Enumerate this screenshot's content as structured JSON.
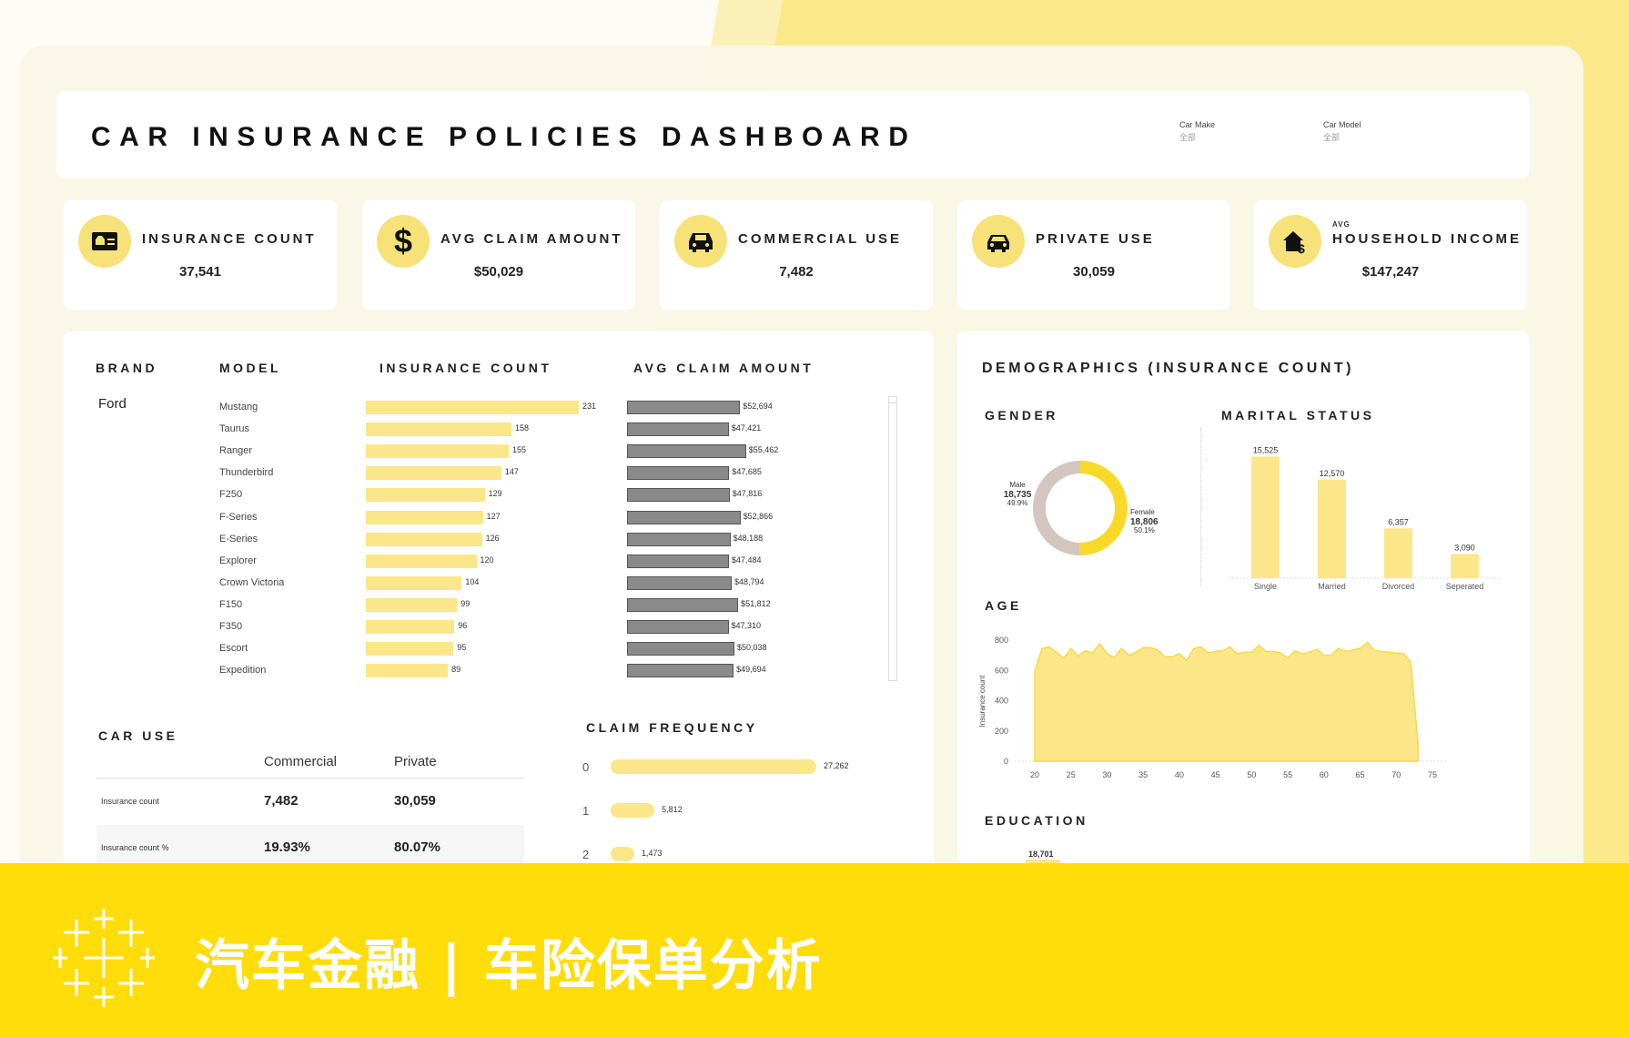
{
  "header": {
    "title": "CAR INSURANCE POLICIES DASHBOARD",
    "filters": [
      {
        "label": "Car Make",
        "value": "全部"
      },
      {
        "label": "Car Model",
        "value": "全部"
      }
    ]
  },
  "kpis": [
    {
      "icon": "id-card-icon",
      "label": "INSURANCE COUNT",
      "sup": "",
      "value": "37,541"
    },
    {
      "icon": "dollar-icon",
      "label": "AVG CLAIM AMOUNT",
      "sup": "",
      "value": "$50,029"
    },
    {
      "icon": "commercial-car-icon",
      "label": "COMMERCIAL USE",
      "sup": "",
      "value": "7,482"
    },
    {
      "icon": "car-icon",
      "label": "PRIVATE USE",
      "sup": "",
      "value": "30,059"
    },
    {
      "icon": "house-dollar-icon",
      "label": "HOUSEHOLD INCOME",
      "sup": "AVG",
      "value": "$147,247"
    }
  ],
  "models_table": {
    "headers": {
      "brand": "BRAND",
      "model": "MODEL",
      "count": "INSURANCE COUNT",
      "claim": "AVG CLAIM AMOUNT"
    },
    "brand": "Ford",
    "rows": [
      {
        "model": "Mustang",
        "count": 231,
        "count_label": "231",
        "claim": 52694,
        "claim_label": "$52,694"
      },
      {
        "model": "Taurus",
        "count": 158,
        "count_label": "158",
        "claim": 47421,
        "claim_label": "$47,421"
      },
      {
        "model": "Ranger",
        "count": 155,
        "count_label": "155",
        "claim": 55462,
        "claim_label": "$55,462"
      },
      {
        "model": "Thunderbird",
        "count": 147,
        "count_label": "147",
        "claim": 47685,
        "claim_label": "$47,685"
      },
      {
        "model": "F250",
        "count": 129,
        "count_label": "129",
        "claim": 47816,
        "claim_label": "$47,816"
      },
      {
        "model": "F-Series",
        "count": 127,
        "count_label": "127",
        "claim": 52866,
        "claim_label": "$52,866"
      },
      {
        "model": "E-Series",
        "count": 126,
        "count_label": "126",
        "claim": 48188,
        "claim_label": "$48,188"
      },
      {
        "model": "Explorer",
        "count": 120,
        "count_label": "120",
        "claim": 47484,
        "claim_label": "$47,484"
      },
      {
        "model": "Crown Victoria",
        "count": 104,
        "count_label": "104",
        "claim": 48794,
        "claim_label": "$48,794"
      },
      {
        "model": "F150",
        "count": 99,
        "count_label": "99",
        "claim": 51812,
        "claim_label": "$51,812"
      },
      {
        "model": "F350",
        "count": 96,
        "count_label": "96",
        "claim": 47310,
        "claim_label": "$47,310"
      },
      {
        "model": "Escort",
        "count": 95,
        "count_label": "95",
        "claim": 50038,
        "claim_label": "$50,038"
      },
      {
        "model": "Expedition",
        "count": 89,
        "count_label": "89",
        "claim": 49694,
        "claim_label": "$49,694"
      }
    ]
  },
  "car_use": {
    "title": "CAR USE",
    "columns": [
      "Commercial",
      "Private"
    ],
    "rows": [
      {
        "label": "Insurance count",
        "values": [
          "7,482",
          "30,059"
        ]
      },
      {
        "label": "Insurance count %",
        "values": [
          "19.93%",
          "80.07%"
        ]
      }
    ]
  },
  "claim_frequency": {
    "title": "CLAIM FREQUENCY",
    "rows": [
      {
        "label": "0",
        "value": 27262,
        "value_label": "27,262"
      },
      {
        "label": "1",
        "value": 5812,
        "value_label": "5,812"
      },
      {
        "label": "2",
        "value": 1473,
        "value_label": "1,473"
      }
    ]
  },
  "demographics": {
    "title": "DEMOGRAPHICS (INSURANCE COUNT)",
    "gender_title": "GENDER",
    "marital_title": "MARITAL STATUS",
    "age_title": "AGE",
    "education_title": "EDUCATION",
    "education_first_label": "18,701",
    "colors": {
      "female": "#f7d92a",
      "male": "#d2c6bf",
      "bar": "#fbe68a"
    }
  },
  "chart_data": [
    {
      "type": "pie",
      "title": "GENDER",
      "categories": [
        "Male",
        "Female"
      ],
      "values": [
        18735,
        18806
      ],
      "value_labels": [
        "18,735",
        "18,806"
      ],
      "percent_labels": [
        "49.9%",
        "50.1%"
      ]
    },
    {
      "type": "bar",
      "title": "MARITAL STATUS",
      "categories": [
        "Single",
        "Married",
        "Divorced",
        "Seperated"
      ],
      "values": [
        15525,
        12570,
        6357,
        3090
      ],
      "value_labels": [
        "15,525",
        "12,570",
        "6,357",
        "3,090"
      ],
      "ylim": [
        0,
        16000
      ]
    },
    {
      "type": "area",
      "title": "AGE",
      "xlabel": "",
      "ylabel": "Insurance count",
      "ylim": [
        0,
        800
      ],
      "xlim": [
        18,
        75
      ],
      "yticks": [
        "0",
        "200",
        "400",
        "600",
        "800"
      ],
      "xticks": [
        "20",
        "25",
        "30",
        "35",
        "40",
        "45",
        "50",
        "55",
        "60",
        "65",
        "70",
        "75"
      ],
      "x": [
        20,
        21,
        22,
        23,
        24,
        25,
        26,
        27,
        28,
        29,
        30,
        31,
        32,
        33,
        34,
        35,
        36,
        37,
        38,
        39,
        40,
        41,
        42,
        43,
        44,
        45,
        46,
        47,
        48,
        49,
        50,
        51,
        52,
        53,
        54,
        55,
        56,
        57,
        58,
        59,
        60,
        61,
        62,
        63,
        64,
        65,
        66,
        67,
        68,
        69,
        70,
        71,
        72,
        73
      ],
      "values": [
        590,
        745,
        755,
        720,
        680,
        745,
        695,
        730,
        715,
        775,
        710,
        685,
        745,
        700,
        720,
        750,
        750,
        735,
        690,
        690,
        710,
        665,
        745,
        755,
        715,
        725,
        730,
        755,
        710,
        720,
        720,
        765,
        725,
        725,
        715,
        680,
        730,
        710,
        720,
        740,
        700,
        700,
        745,
        725,
        735,
        745,
        785,
        730,
        725,
        720,
        715,
        710,
        655,
        120
      ]
    }
  ],
  "banner": {
    "text": "汽车金融 | 车险保单分析",
    "logo": "tableau-logo-icon"
  }
}
